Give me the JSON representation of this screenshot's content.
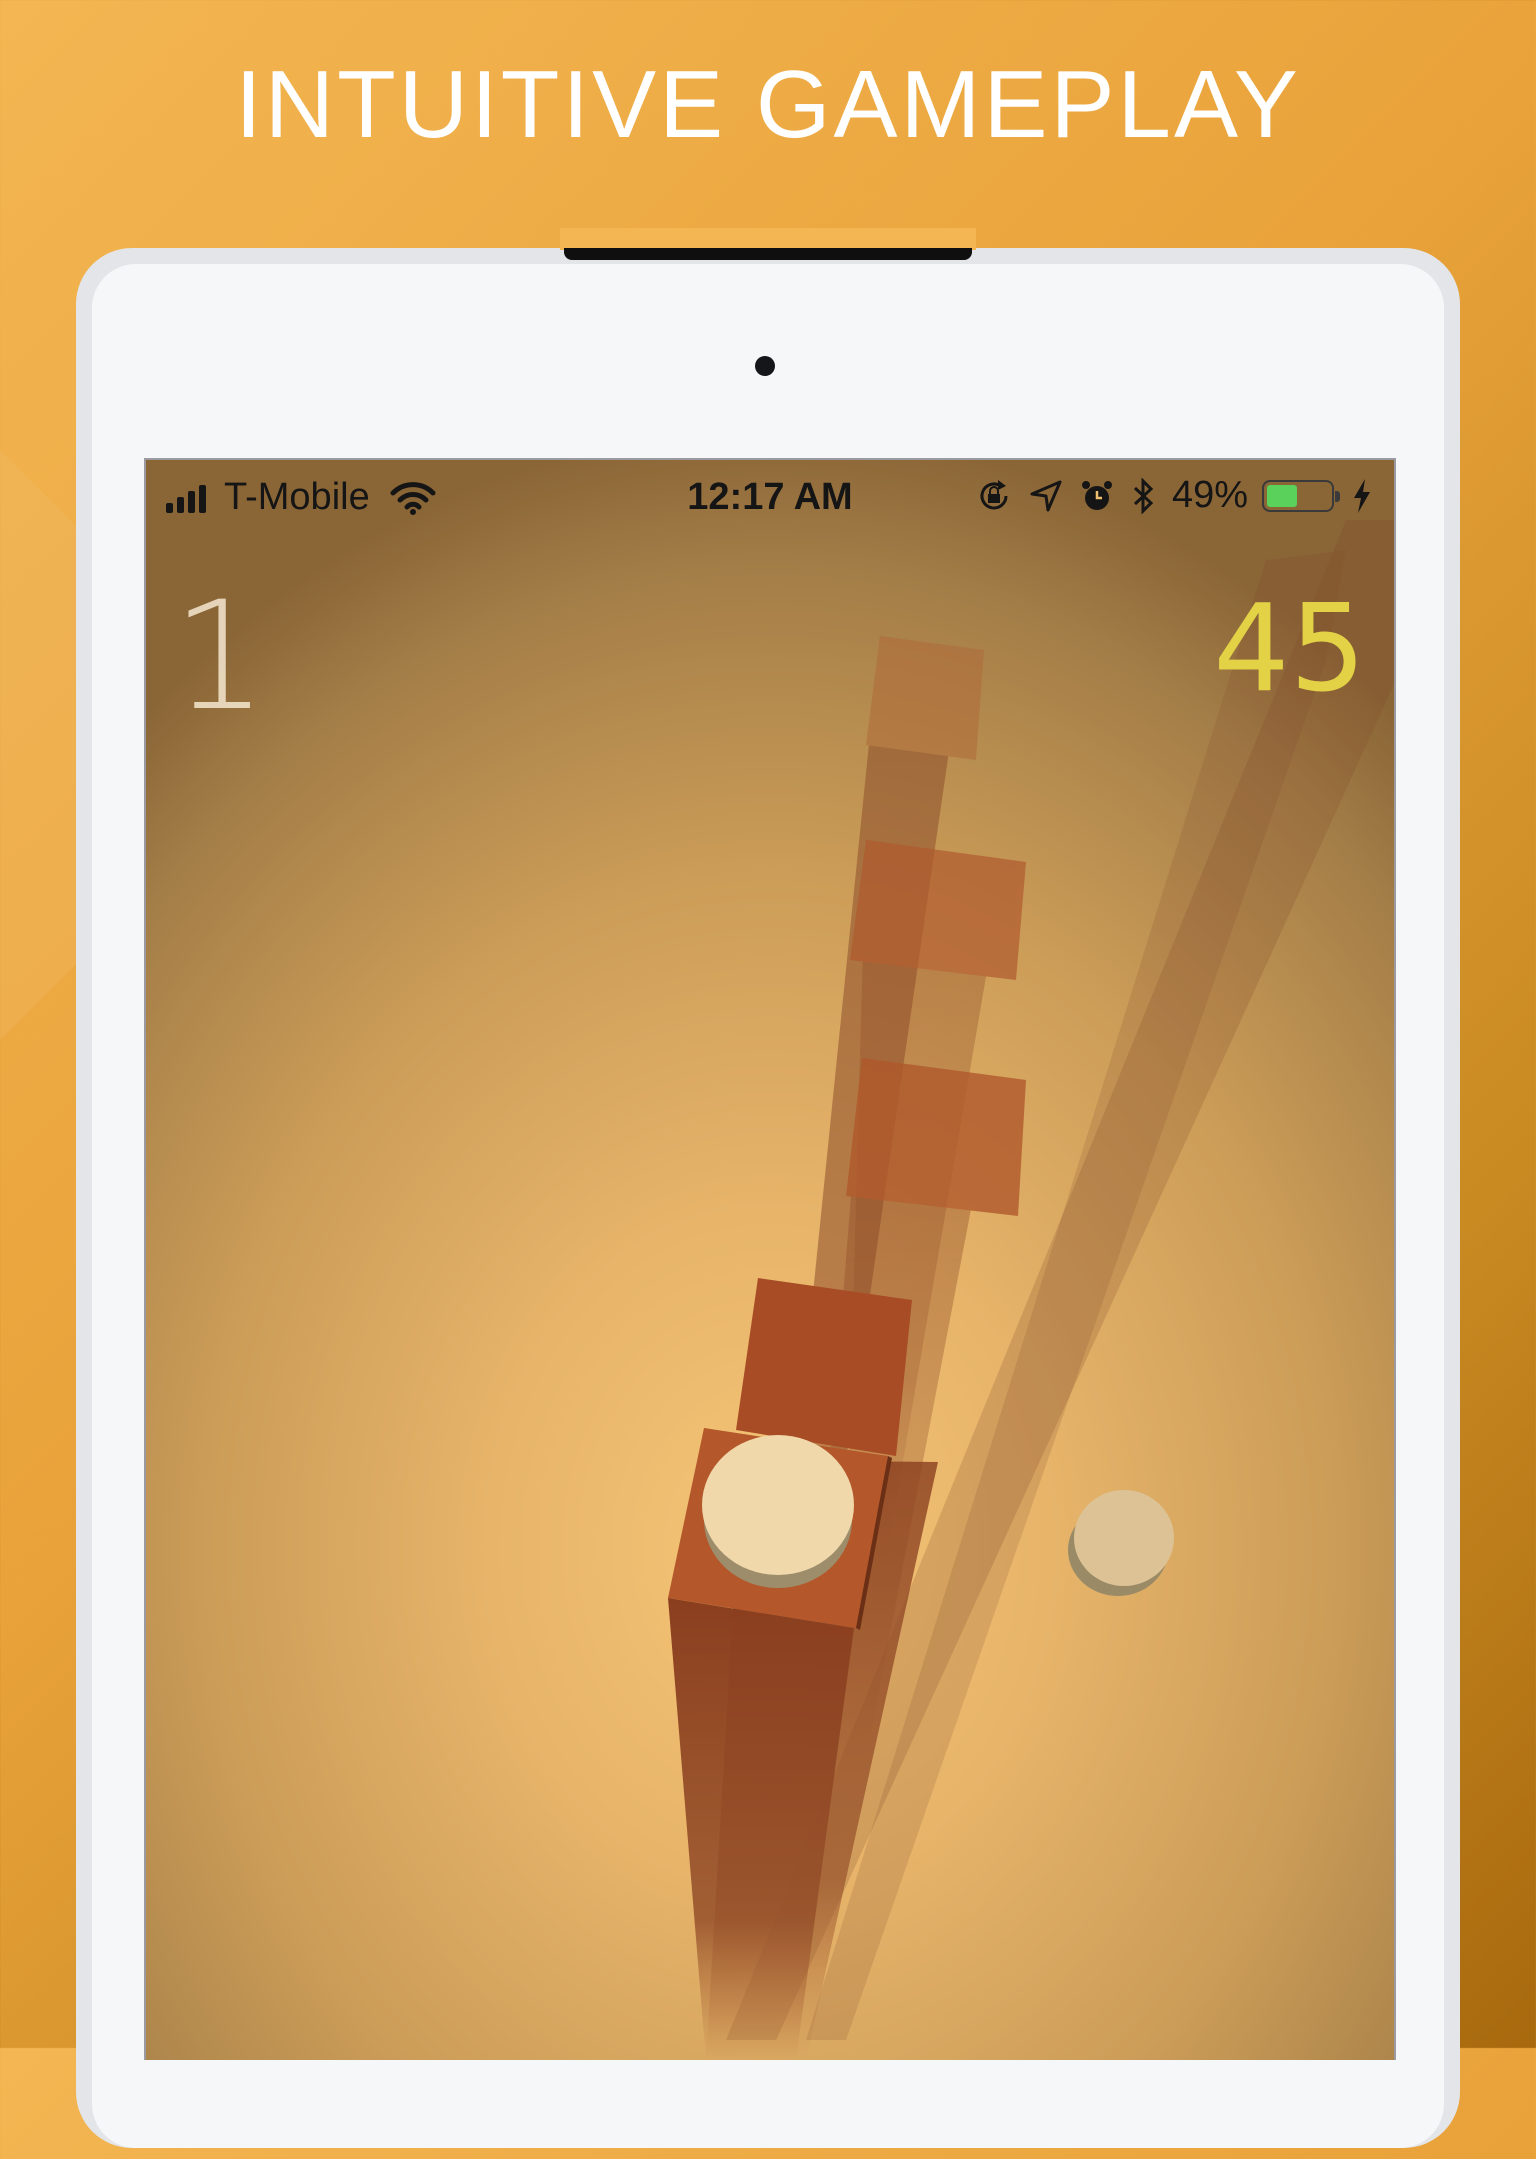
{
  "headline": "INTUITIVE GAMEPLAY",
  "status_bar": {
    "carrier": "T-Mobile",
    "time": "12:17 AM",
    "battery_percent": "49%",
    "battery_level": 0.49,
    "icons": [
      "signal-icon",
      "wifi-icon",
      "orientation-lock-icon",
      "location-icon",
      "alarm-icon",
      "bluetooth-icon",
      "battery-icon",
      "charging-icon"
    ]
  },
  "game": {
    "level": "1",
    "score": "45"
  },
  "colors": {
    "background": "#f3b652",
    "pillar": "#a9532a",
    "ball": "#f0d8aa",
    "score": "#e3d146"
  }
}
